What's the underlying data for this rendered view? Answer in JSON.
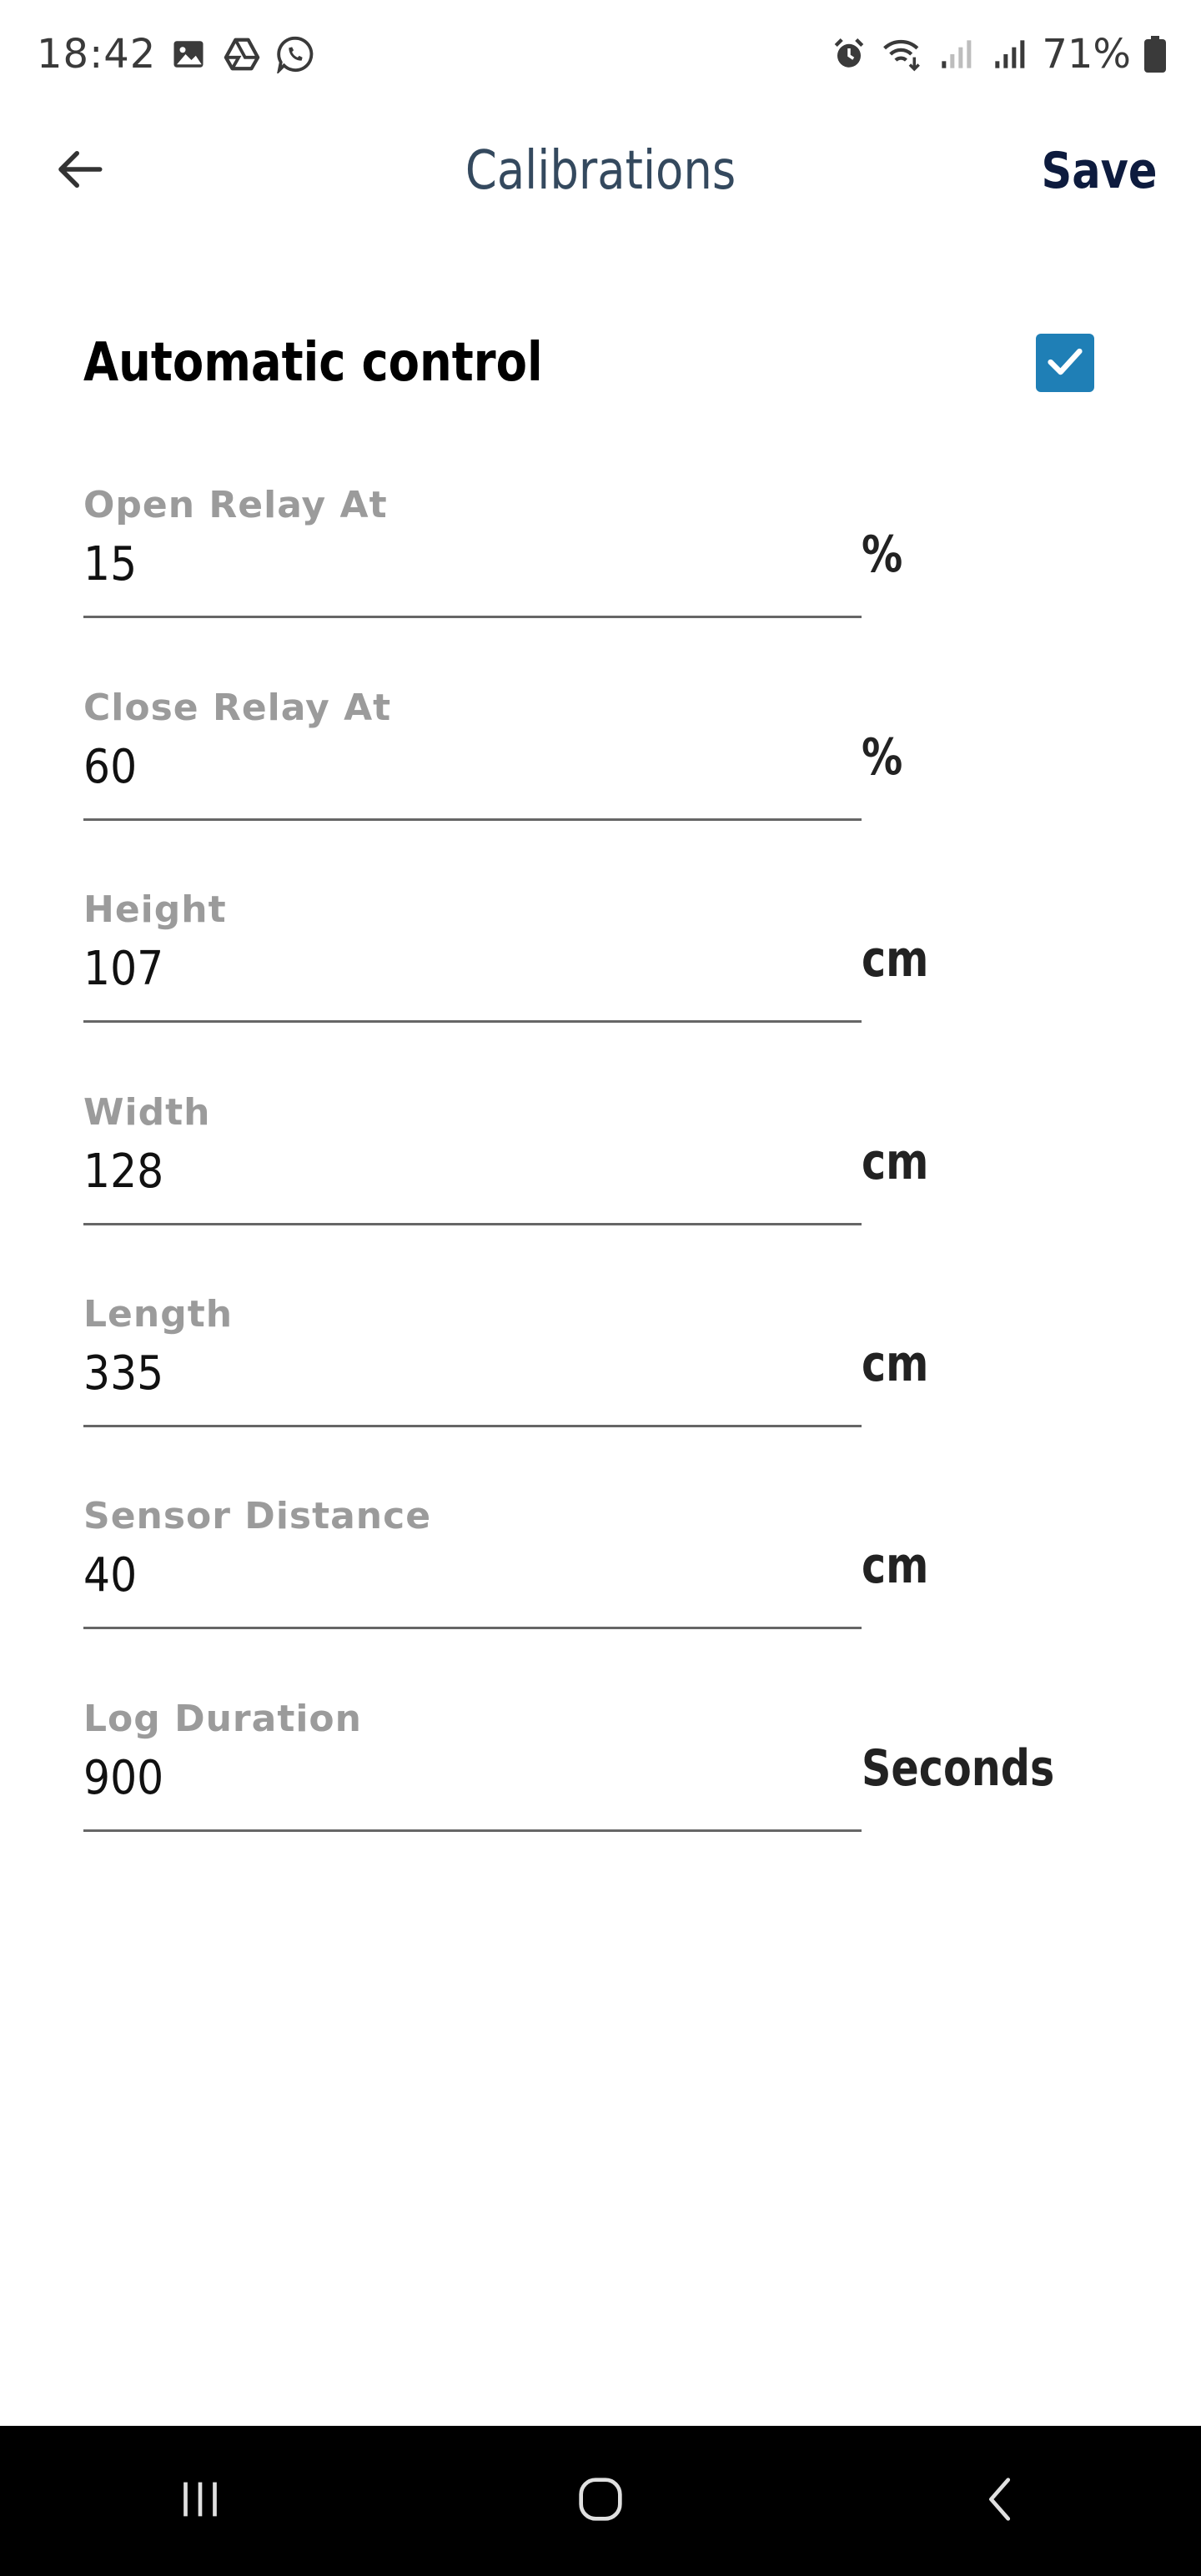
{
  "status_bar": {
    "time": "18:42",
    "battery_percent": "71%",
    "left_icons": [
      "gallery-icon",
      "drive-icon",
      "whatsapp-icon"
    ],
    "right_icons": [
      "alarm-icon",
      "wifi-icon",
      "signal-weak-icon",
      "signal-icon",
      "battery-icon"
    ]
  },
  "app_bar": {
    "title": "Calibrations",
    "save_label": "Save",
    "back_icon": "arrow-left-icon"
  },
  "automatic_control": {
    "label": "Automatic control",
    "checked": true,
    "checkbox_color": "#1f7fb6"
  },
  "fields": [
    {
      "label": "Open Relay At",
      "value": "15",
      "unit": "%"
    },
    {
      "label": "Close Relay At",
      "value": "60",
      "unit": "%"
    },
    {
      "label": "Height",
      "value": "107",
      "unit": "cm"
    },
    {
      "label": "Width",
      "value": "128",
      "unit": "cm"
    },
    {
      "label": "Length",
      "value": "335",
      "unit": "cm"
    },
    {
      "label": "Sensor Distance",
      "value": "40",
      "unit": "cm"
    },
    {
      "label": "Log Duration",
      "value": "900",
      "unit": "Seconds"
    }
  ],
  "nav_bar": {
    "buttons": [
      "recent-apps-icon",
      "home-icon",
      "back-icon"
    ]
  }
}
